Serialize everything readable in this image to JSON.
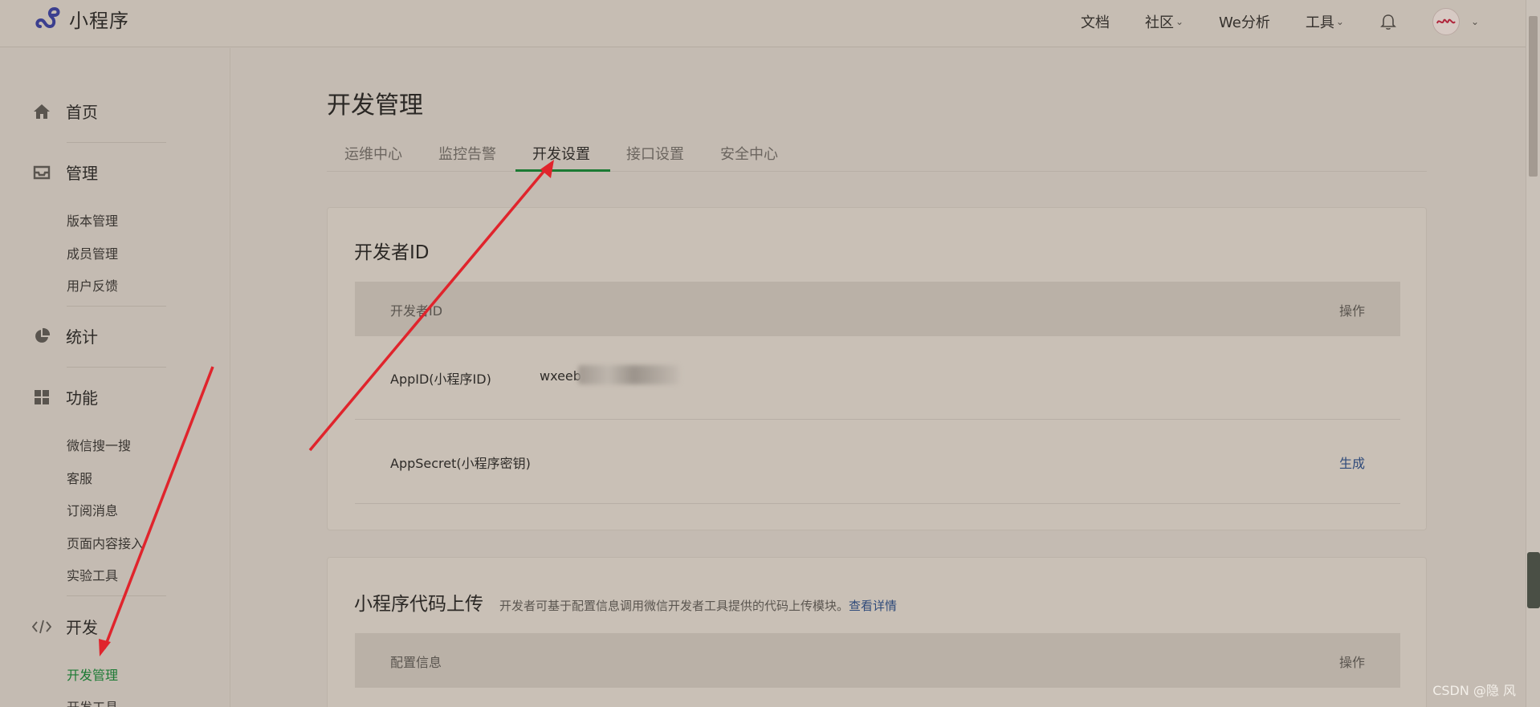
{
  "topbar": {
    "logo_text": "小程序",
    "nav": [
      {
        "label": "文档",
        "has_caret": false
      },
      {
        "label": "社区",
        "has_caret": true
      },
      {
        "label": "We分析",
        "has_caret": false
      },
      {
        "label": "工具",
        "has_caret": true
      }
    ],
    "bell_icon": "bell-icon",
    "avatar_icon": "avatar"
  },
  "sidebar": {
    "sections": [
      {
        "title": "首页",
        "icon": "home-icon",
        "items": []
      },
      {
        "title": "管理",
        "icon": "inbox-icon",
        "items": [
          "版本管理",
          "成员管理",
          "用户反馈"
        ]
      },
      {
        "title": "统计",
        "icon": "pie-chart-icon",
        "items": []
      },
      {
        "title": "功能",
        "icon": "grid-icon",
        "items": [
          "微信搜一搜",
          "客服",
          "订阅消息",
          "页面内容接入",
          "实验工具"
        ]
      },
      {
        "title": "开发",
        "icon": "code-icon",
        "items": [
          "开发管理",
          "开发工具"
        ]
      }
    ],
    "active_item": "开发管理"
  },
  "main": {
    "title": "开发管理",
    "tabs": [
      "运维中心",
      "监控告警",
      "开发设置",
      "接口设置",
      "安全中心"
    ],
    "active_tab": "开发设置",
    "developer_id_card": {
      "title": "开发者ID",
      "header_left": "开发者ID",
      "header_right": "操作",
      "rows": [
        {
          "label": "AppID(小程序ID)",
          "value": "wxeeb",
          "value_blurred": true,
          "action": ""
        },
        {
          "label": "AppSecret(小程序密钥)",
          "value": "",
          "value_blurred": false,
          "action": "生成"
        }
      ]
    },
    "upload_card": {
      "title": "小程序代码上传",
      "desc": "开发者可基于配置信息调用微信开发者工具提供的代码上传模块。",
      "desc_link": "查看详情",
      "header_left": "配置信息",
      "header_right": "操作"
    }
  },
  "watermark": "CSDN @隐 风",
  "colors": {
    "accent_green": "#1c7a34",
    "link_blue": "#2e4a7a",
    "arrow_red": "#e0242c"
  }
}
